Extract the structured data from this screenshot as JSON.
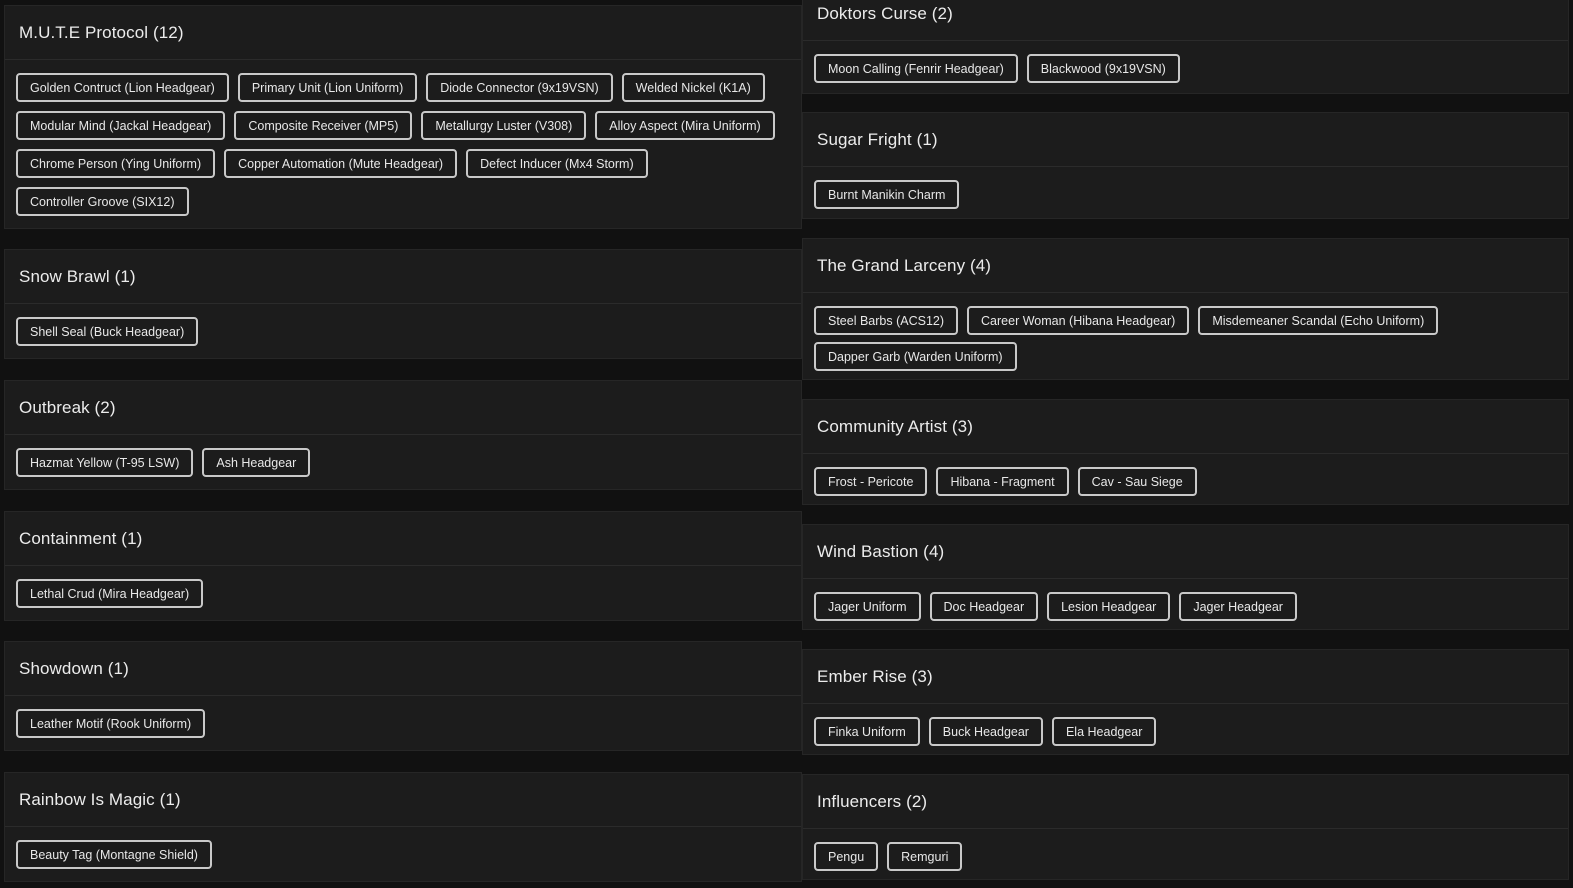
{
  "left_column": [
    {
      "title": "M.U.T.E Protocol (12)",
      "items": [
        "Golden Contruct (Lion Headgear)",
        "Primary Unit (Lion Uniform)",
        "Diode Connector (9x19VSN)",
        "Welded Nickel (K1A)",
        "Modular Mind (Jackal Headgear)",
        "Composite Receiver (MP5)",
        "Metallurgy Luster (V308)",
        "Alloy Aspect (Mira Uniform)",
        "Chrome Person (Ying Uniform)",
        "Copper Automation (Mute Headgear)",
        "Defect Inducer (Mx4 Storm)",
        "Controller Groove (SIX12)"
      ]
    },
    {
      "title": "Snow Brawl (1)",
      "items": [
        "Shell Seal (Buck Headgear)"
      ]
    },
    {
      "title": "Outbreak (2)",
      "items": [
        "Hazmat Yellow (T-95 LSW)",
        "Ash Headgear"
      ]
    },
    {
      "title": "Containment (1)",
      "items": [
        "Lethal Crud (Mira Headgear)"
      ]
    },
    {
      "title": "Showdown (1)",
      "items": [
        "Leather Motif (Rook Uniform)"
      ]
    },
    {
      "title": "Rainbow Is Magic (1)",
      "items": [
        "Beauty Tag (Montagne Shield)"
      ]
    }
  ],
  "right_column": [
    {
      "title": "Doktors Curse (2)",
      "items": [
        "Moon Calling (Fenrir Headgear)",
        "Blackwood (9x19VSN)"
      ]
    },
    {
      "title": "Sugar Fright (1)",
      "items": [
        "Burnt Manikin Charm"
      ]
    },
    {
      "title": "The Grand Larceny (4)",
      "items": [
        "Steel Barbs (ACS12)",
        "Career Woman (Hibana Headgear)",
        "Misdemeaner Scandal (Echo Uniform)",
        "Dapper Garb (Warden Uniform)"
      ]
    },
    {
      "title": "Community Artist (3)",
      "items": [
        "Frost - Pericote",
        "Hibana - Fragment",
        "Cav - Sau Siege"
      ]
    },
    {
      "title": "Wind Bastion (4)",
      "items": [
        "Jager Uniform",
        "Doc Headgear",
        "Lesion Headgear",
        "Jager Headgear"
      ]
    },
    {
      "title": "Ember Rise (3)",
      "items": [
        "Finka Uniform",
        "Buck Headgear",
        "Ela Headgear"
      ]
    },
    {
      "title": "Influencers (2)",
      "items": [
        "Pengu",
        "Remguri"
      ]
    }
  ]
}
